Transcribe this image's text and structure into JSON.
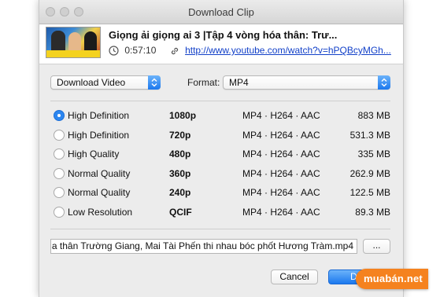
{
  "window": {
    "title": "Download Clip"
  },
  "clip": {
    "title": "Giọng ải giọng ai 3 |Tập 4 vòng hóa thân: Trư...",
    "duration": "0:57:10",
    "url": "http://www.youtube.com/watch?v=hPQBcyMGh..."
  },
  "controls": {
    "action_value": "Download Video",
    "format_label": "Format:",
    "format_value": "MP4"
  },
  "qualities": [
    {
      "label": "High Definition",
      "resolution": "1080p",
      "format": "MP4 · H264 · AAC",
      "size": "883 MB",
      "selected": true
    },
    {
      "label": "High Definition",
      "resolution": "720p",
      "format": "MP4 · H264 · AAC",
      "size": "531.3 MB",
      "selected": false
    },
    {
      "label": "High Quality",
      "resolution": "480p",
      "format": "MP4 · H264 · AAC",
      "size": "335 MB",
      "selected": false
    },
    {
      "label": "Normal Quality",
      "resolution": "360p",
      "format": "MP4 · H264 · AAC",
      "size": "262.9 MB",
      "selected": false
    },
    {
      "label": "Normal Quality",
      "resolution": "240p",
      "format": "MP4 · H264 · AAC",
      "size": "122.5 MB",
      "selected": false
    },
    {
      "label": "Low Resolution",
      "resolution": "QCIF",
      "format": "MP4 · H264 · AAC",
      "size": "89.3 MB",
      "selected": false
    }
  ],
  "output": {
    "filename": "a thân  Trường Giang, Mai Tài Phến thi nhau  bóc phốt  Hương Tràm.mp4",
    "browse_label": "..."
  },
  "buttons": {
    "cancel": "Cancel",
    "download": "Dow"
  },
  "watermark": {
    "text": "muabán.net",
    "color": "#f5821f"
  },
  "colors": {
    "accent": "#1b78ee",
    "link": "#1240c8"
  }
}
